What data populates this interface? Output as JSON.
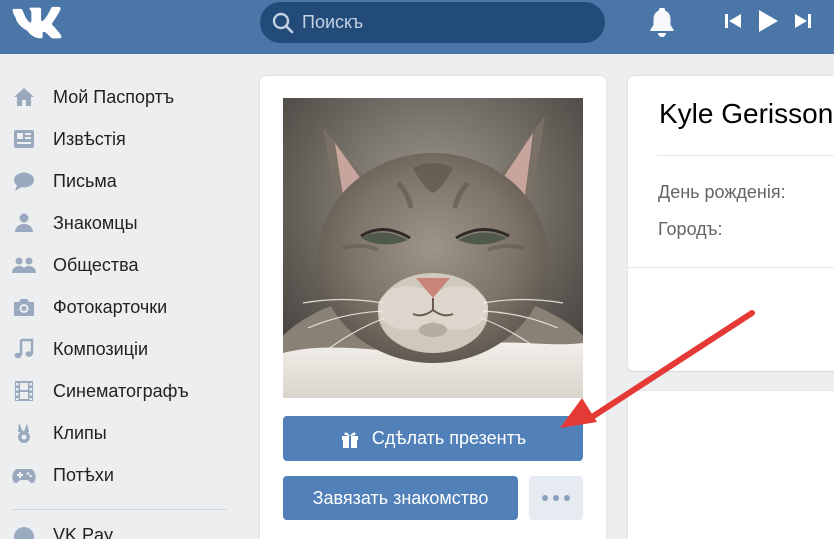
{
  "header": {
    "search_placeholder": "Поискъ",
    "brand_color": "#4a76a8"
  },
  "sidebar": {
    "items": [
      {
        "label": "Мой Паспортъ",
        "icon": "home-icon"
      },
      {
        "label": "Извѣстія",
        "icon": "news-icon"
      },
      {
        "label": "Письма",
        "icon": "messages-icon"
      },
      {
        "label": "Знакомцы",
        "icon": "friends-icon"
      },
      {
        "label": "Общества",
        "icon": "communities-icon"
      },
      {
        "label": "Фотокарточки",
        "icon": "camera-icon"
      },
      {
        "label": "Композиціи",
        "icon": "music-note-icon"
      },
      {
        "label": "Синематографъ",
        "icon": "film-icon"
      },
      {
        "label": "Клипы",
        "icon": "clips-icon"
      },
      {
        "label": "Потѣхи",
        "icon": "gamepad-icon"
      }
    ],
    "extra_label": "VK Pay"
  },
  "profile": {
    "photo_subject": "cat",
    "gift_button": "Сдѣлать презентъ",
    "friend_button": "Завязать знакомство",
    "name": "Kyle Gerisson",
    "birthday_label": "День рожденія:",
    "city_label": "Городъ:"
  },
  "annotation": {
    "arrow_color": "#e53935"
  }
}
